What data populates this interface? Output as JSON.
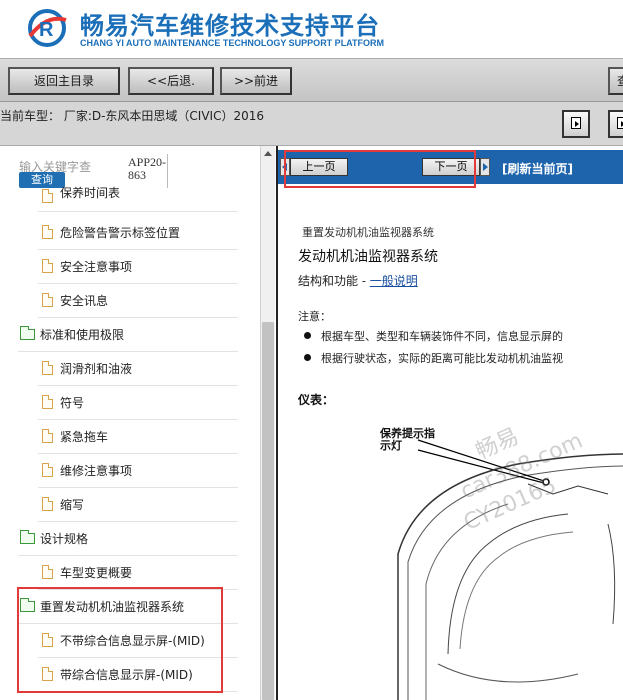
{
  "header": {
    "brand_cn": "畅易汽车维修技术支持平台",
    "brand_en": "CHANG YI AUTO MAINTENANCE TECHNOLOGY SUPPORT PLATFORM"
  },
  "toolbar": {
    "home_label": "返回主目录",
    "back_label": "<<后退.",
    "forward_label": ">>前进",
    "right_label": "查"
  },
  "model_bar": {
    "current_model": "当前车型：  厂家:D-东风本田思域（CIVIC）2016"
  },
  "sidebar": {
    "search_placeholder": "输入关键字查",
    "search_button": "查询",
    "app_version": "APP20-863",
    "items": [
      {
        "label": "保养时间表",
        "type": "doc"
      },
      {
        "label": "危险警告警示标签位置",
        "type": "doc"
      },
      {
        "label": "安全注意事项",
        "type": "doc"
      },
      {
        "label": "安全讯息",
        "type": "doc"
      },
      {
        "label": "标准和使用极限",
        "type": "folder"
      },
      {
        "label": "润滑剂和油液",
        "type": "doc"
      },
      {
        "label": "符号",
        "type": "doc"
      },
      {
        "label": "紧急拖车",
        "type": "doc"
      },
      {
        "label": "维修注意事项",
        "type": "doc"
      },
      {
        "label": "缩写",
        "type": "doc"
      },
      {
        "label": "设计规格",
        "type": "folder"
      },
      {
        "label": "车型变更概要",
        "type": "doc"
      },
      {
        "label": "重置发动机机油监视器系统",
        "type": "folder"
      },
      {
        "label": "不带综合信息显示屏-(MID)",
        "type": "doc"
      },
      {
        "label": "带综合信息显示屏-(MID)",
        "type": "doc"
      }
    ]
  },
  "content": {
    "prev_page": "上一页",
    "next_page": "下一页",
    "refresh": "[刷新当前页]",
    "breadcrumb": "重置发动机机油监视器系统",
    "title": "发动机机油监视器系统",
    "subtitle_prefix": "结构和功能  - ",
    "subtitle_link": "一般说明",
    "note_label": "注意：",
    "notes": [
      "根据车型、类型和车辆装饰件不同，信息显示屏的",
      "根据行驶状态，实际的距离可能比发动机机油监视"
    ],
    "panel_label": "仪表：",
    "callout": "保养提示指示灯",
    "watermark_line1": "畅易",
    "watermark_line2": "car388.com",
    "watermark_line3": "CY20165"
  },
  "colors": {
    "brand_blue": "#1b6fb8",
    "nav_blue": "#1e64ac",
    "highlight_red": "#e03a3a"
  }
}
